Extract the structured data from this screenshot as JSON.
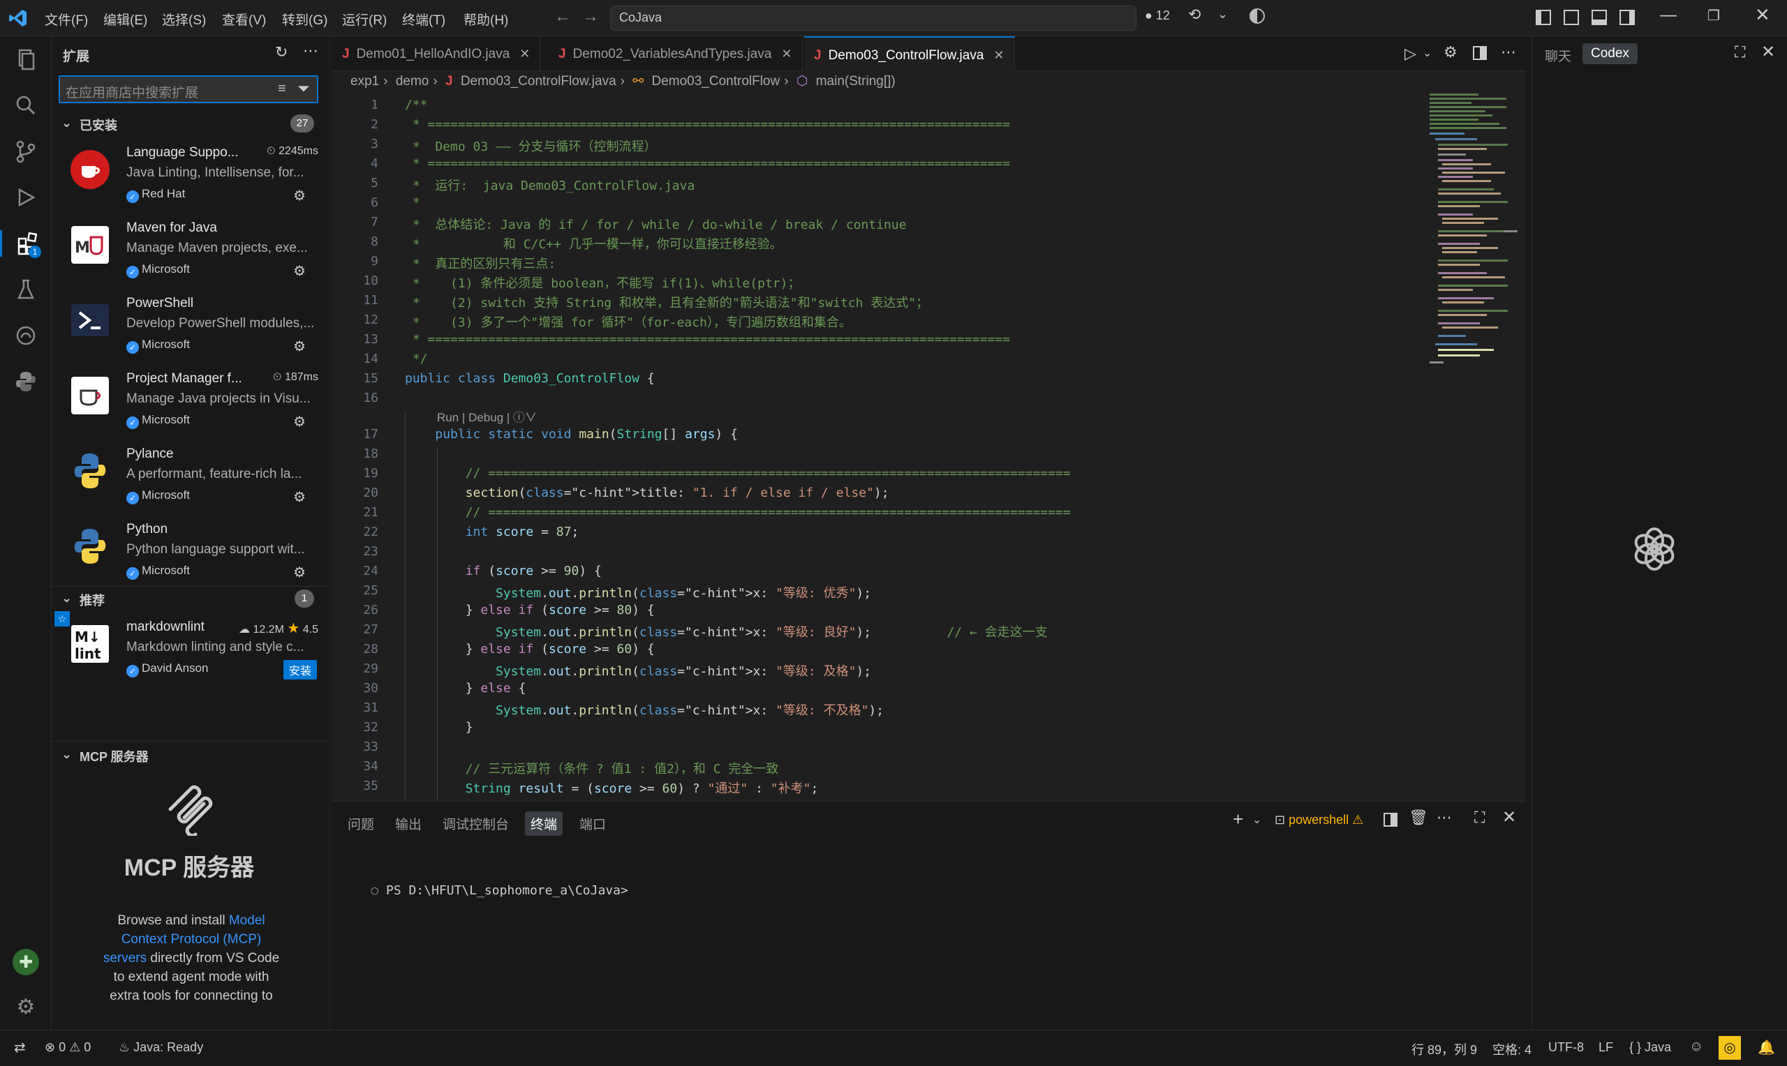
{
  "titlebar": {
    "menus": [
      "文件(F)",
      "编辑(E)",
      "选择(S)",
      "查看(V)",
      "转到(G)",
      "运行(R)",
      "终端(T)",
      "帮助(H)"
    ],
    "search_text": "CoJava",
    "changes_count": "12"
  },
  "sidebar": {
    "title": "扩展",
    "search_placeholder": "在应用商店中搜索扩展",
    "installed_label": "已安装",
    "installed_count": "27",
    "installed": [
      {
        "name": "Language Suppo...",
        "meta": "2245ms",
        "desc": "Java Linting, Intellisense, for...",
        "publisher": "Red Hat"
      },
      {
        "name": "Maven for Java",
        "meta": "",
        "desc": "Manage Maven projects, exe...",
        "publisher": "Microsoft"
      },
      {
        "name": "PowerShell",
        "meta": "",
        "desc": "Develop PowerShell modules,...",
        "publisher": "Microsoft"
      },
      {
        "name": "Project Manager f...",
        "meta": "187ms",
        "desc": "Manage Java projects in Visu...",
        "publisher": "Microsoft"
      },
      {
        "name": "Pylance",
        "meta": "",
        "desc": "A performant, feature-rich la...",
        "publisher": "Microsoft"
      },
      {
        "name": "Python",
        "meta": "",
        "desc": "Python language support wit...",
        "publisher": "Microsoft"
      }
    ],
    "recommended_label": "推荐",
    "recommended_count": "1",
    "recommended": {
      "name": "markdownlint",
      "downloads": "12.2M",
      "rating": "4.5",
      "desc": "Markdown linting and style c...",
      "publisher": "David Anson",
      "install_label": "安装"
    },
    "mcp_label": "MCP 服务器",
    "mcp_title": "MCP 服务器",
    "mcp_text_1": "Browse and install",
    "mcp_link": "Model Context Protocol (MCP) servers",
    "mcp_text_2": "directly from VS Code to extend agent mode with extra tools for connecting to"
  },
  "editor": {
    "tabs": [
      {
        "label": "Demo01_HelloAndIO.java",
        "active": false
      },
      {
        "label": "Demo02_VariablesAndTypes.java",
        "active": false
      },
      {
        "label": "Demo03_ControlFlow.java",
        "active": true
      }
    ],
    "breadcrumb": [
      "exp1",
      "demo",
      "Demo03_ControlFlow.java",
      "Demo03_ControlFlow",
      "main(String[])"
    ],
    "codelens": "Run | Debug | ⓘ∨",
    "line_numbers": [
      "1",
      "2",
      "3",
      "4",
      "5",
      "6",
      "7",
      "8",
      "9",
      "10",
      "11",
      "12",
      "13",
      "14",
      "15",
      "16",
      "17",
      "18",
      "19",
      "20",
      "21",
      "22",
      "23",
      "24",
      "25",
      "26",
      "27",
      "28",
      "29",
      "30",
      "31",
      "32",
      "33",
      "34",
      "35"
    ]
  },
  "panel": {
    "tabs": [
      "问题",
      "输出",
      "调试控制台",
      "终端",
      "端口"
    ],
    "active_tab": "终端",
    "shell": "powershell",
    "prompt": "PS D:\\HFUT\\L_sophomore_a\\CoJava>"
  },
  "auxbar": {
    "tabs": [
      "聊天",
      "Codex"
    ]
  },
  "statusbar": {
    "errors": "0",
    "warnings": "0",
    "java_status": "Java: Ready",
    "cursor": "行 89，列 9",
    "spaces": "空格: 4",
    "encoding": "UTF-8",
    "eol": "LF",
    "language": "Java"
  },
  "colors": {
    "accent": "#0078d4",
    "link": "#3794ff",
    "comment": "#6a9955",
    "keyword": "#569cd6",
    "string": "#ce9178"
  }
}
